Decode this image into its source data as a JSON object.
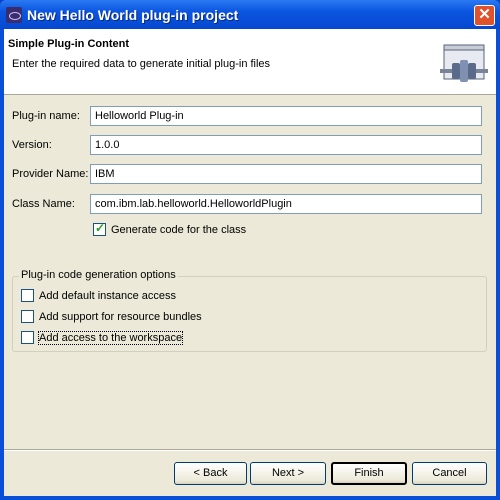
{
  "window": {
    "title": "New Hello World plug-in project",
    "close_label": "✕"
  },
  "header": {
    "title": "Simple Plug-in Content",
    "description": "Enter the required data to generate initial plug-in files",
    "icon": "plugin-wizard-icon"
  },
  "fields": [
    {
      "label": "Plug-in name:",
      "value": "Helloworld Plug-in"
    },
    {
      "label": "Version:",
      "value": "1.0.0"
    },
    {
      "label": "Provider Name:",
      "value": "IBM"
    },
    {
      "label": "Class Name:",
      "value": "com.ibm.lab.helloworld.HelloworldPlugin"
    }
  ],
  "generate": {
    "label": "Generate code for the class",
    "checked": true
  },
  "options": {
    "title": "Plug-in code generation options",
    "items": [
      {
        "label": "Add default instance access",
        "checked": false
      },
      {
        "label": "Add support for resource bundles",
        "checked": false
      },
      {
        "label": "Add access to the workspace",
        "checked": false
      }
    ]
  },
  "buttons": {
    "back": "< Back",
    "next": "Next >",
    "finish": "Finish",
    "cancel": "Cancel"
  }
}
